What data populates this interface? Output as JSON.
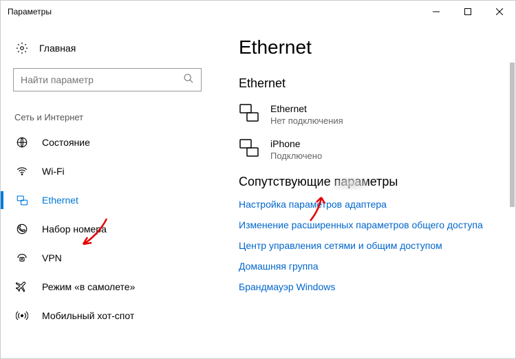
{
  "titlebar": {
    "title": "Параметры"
  },
  "sidebar": {
    "home": "Главная",
    "search_placeholder": "Найти параметр",
    "section": "Сеть и Интернет",
    "items": [
      {
        "label": "Состояние"
      },
      {
        "label": "Wi-Fi"
      },
      {
        "label": "Ethernet"
      },
      {
        "label": "Набор номера"
      },
      {
        "label": "VPN"
      },
      {
        "label": "Режим «в самолете»"
      },
      {
        "label": "Мобильный хот-спот"
      }
    ]
  },
  "main": {
    "heading": "Ethernet",
    "subheading": "Ethernet",
    "connections": [
      {
        "name": "Ethernet",
        "status": "Нет подключения"
      },
      {
        "name": "iPhone",
        "status": "Подключено"
      }
    ],
    "related_heading": "Сопутствующие параметры",
    "links": [
      "Настройка параметров адаптера",
      "Изменение расширенных параметров общего доступа",
      "Центр управления сетями и общим доступом",
      "Домашняя группа",
      "Брандмауэр Windows"
    ]
  }
}
